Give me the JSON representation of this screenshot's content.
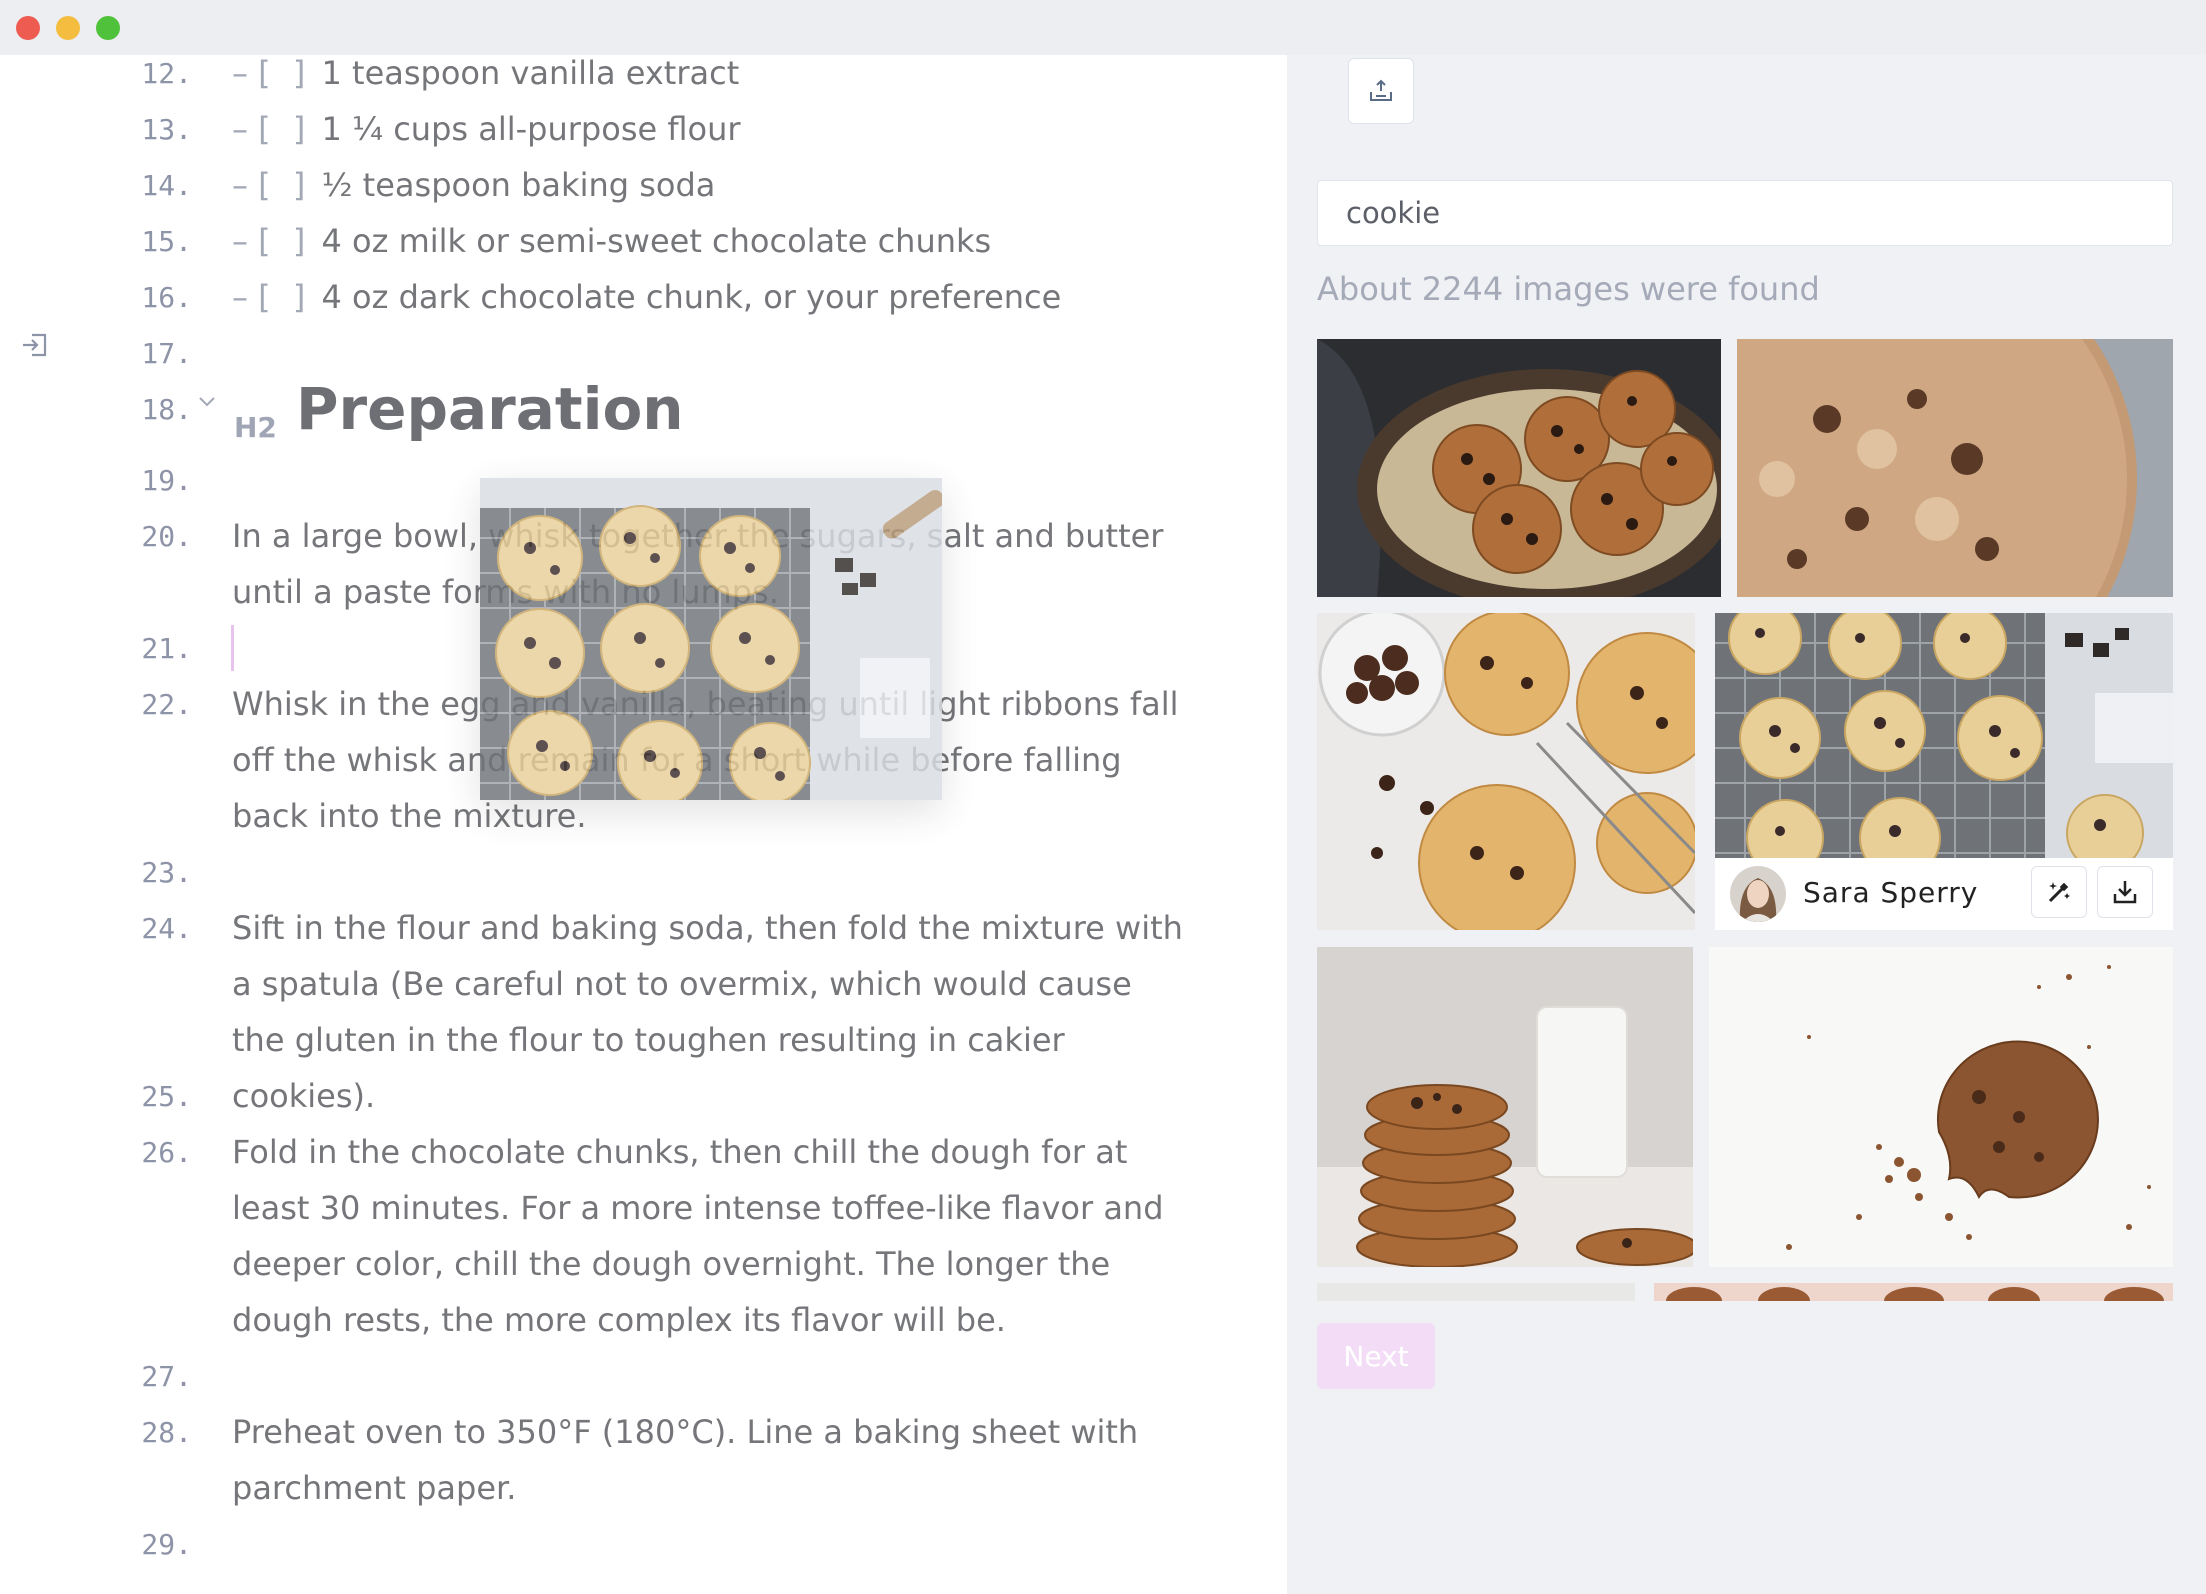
{
  "editor": {
    "lines": [
      {
        "num": "12.",
        "text": "1 teaspoon vanilla extract"
      },
      {
        "num": "13.",
        "text": "1 ¼ cups all-purpose flour"
      },
      {
        "num": "14.",
        "text": "½ teaspoon baking soda"
      },
      {
        "num": "15.",
        "text": "4 oz milk or semi-sweet chocolate chunks"
      },
      {
        "num": "16.",
        "text": "4 oz dark chocolate chunk, or your preference"
      },
      {
        "num": "17.",
        "text": ""
      },
      {
        "num": "18.",
        "text": "Preparation",
        "tag": "H2"
      },
      {
        "num": "19.",
        "text": ""
      },
      {
        "num": "20.",
        "text": "In a large bowl, whisk together the sugars, salt and butter until a paste forms with no lumps."
      },
      {
        "num": "21.",
        "text": ""
      },
      {
        "num": "22.",
        "text": "Whisk in the egg and vanilla, beating until light ribbons fall off the whisk and remain for a short while before falling back into the mixture."
      },
      {
        "num": "23.",
        "text": ""
      },
      {
        "num": "24.",
        "text": "Sift in the flour and baking soda, then fold the mixture with a spatula (Be careful not to overmix, which would cause the gluten in the flour to toughen resulting in cakier cookies)."
      },
      {
        "num": "25.",
        "text": ""
      },
      {
        "num": "26.",
        "text": "Fold in the chocolate chunks, then chill the dough for at least 30 minutes. For a more intense toffee-like flavor and deeper color, chill the dough overnight. The longer the dough rests, the more complex its flavor will be."
      },
      {
        "num": "27.",
        "text": ""
      },
      {
        "num": "28.",
        "text": "Preheat oven to 350°F (180°C). Line a baking sheet with parchment paper."
      },
      {
        "num": "29.",
        "text": ""
      }
    ],
    "checklist_dash": "–",
    "checklist_box": "[ ]"
  },
  "panel": {
    "search_value": "cookie",
    "result_count": "About 2244 images were found",
    "author_name": "Sara Sperry",
    "next_label": "Next"
  },
  "icons": {
    "insert": "tray-upload-icon",
    "sidebar": "sidebar-toggle-icon",
    "magic": "magic-wand-icon",
    "download": "download-icon"
  },
  "colors": {
    "accent": "#f3dcf5",
    "panel_bg": "#f0f1f4",
    "text": "#75767a",
    "line_number": "#8e94a8"
  }
}
